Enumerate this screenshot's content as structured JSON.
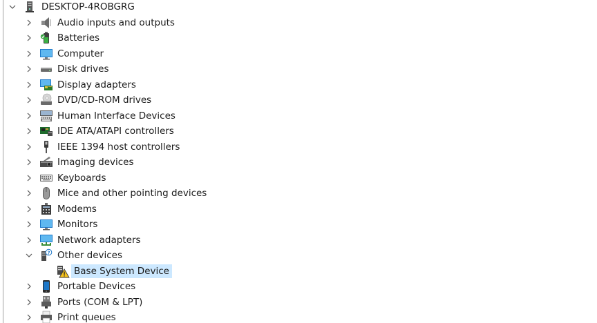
{
  "root": {
    "label": "DESKTOP-4ROBGRG",
    "icon": "computer-root-icon",
    "expanded": true
  },
  "categories": [
    {
      "label": "Audio inputs and outputs",
      "icon": "speaker-icon",
      "expanded": false
    },
    {
      "label": "Batteries",
      "icon": "battery-icon",
      "expanded": false
    },
    {
      "label": "Computer",
      "icon": "monitor-icon",
      "expanded": false
    },
    {
      "label": "Disk drives",
      "icon": "disk-drive-icon",
      "expanded": false
    },
    {
      "label": "Display adapters",
      "icon": "display-adapter-icon",
      "expanded": false
    },
    {
      "label": "DVD/CD-ROM drives",
      "icon": "dvd-drive-icon",
      "expanded": false
    },
    {
      "label": "Human Interface Devices",
      "icon": "hid-icon",
      "expanded": false
    },
    {
      "label": "IDE ATA/ATAPI controllers",
      "icon": "ide-controller-icon",
      "expanded": false
    },
    {
      "label": "IEEE 1394 host controllers",
      "icon": "ieee1394-icon",
      "expanded": false
    },
    {
      "label": "Imaging devices",
      "icon": "camera-icon",
      "expanded": false
    },
    {
      "label": "Keyboards",
      "icon": "keyboard-icon",
      "expanded": false
    },
    {
      "label": "Mice and other pointing devices",
      "icon": "mouse-icon",
      "expanded": false
    },
    {
      "label": "Modems",
      "icon": "modem-icon",
      "expanded": false
    },
    {
      "label": "Monitors",
      "icon": "monitor-icon",
      "expanded": false
    },
    {
      "label": "Network adapters",
      "icon": "network-adapter-icon",
      "expanded": false
    },
    {
      "label": "Other devices",
      "icon": "unknown-device-icon",
      "expanded": true,
      "children": [
        {
          "label": "Base System Device",
          "icon": "warning-device-icon",
          "selected": true
        }
      ]
    },
    {
      "label": "Portable Devices",
      "icon": "portable-device-icon",
      "expanded": false
    },
    {
      "label": "Ports (COM & LPT)",
      "icon": "port-icon",
      "expanded": false
    },
    {
      "label": "Print queues",
      "icon": "printer-icon",
      "expanded": false
    }
  ],
  "colors": {
    "selection": "#cce8ff",
    "chevron": "#555555",
    "text": "#1a1a1a"
  }
}
